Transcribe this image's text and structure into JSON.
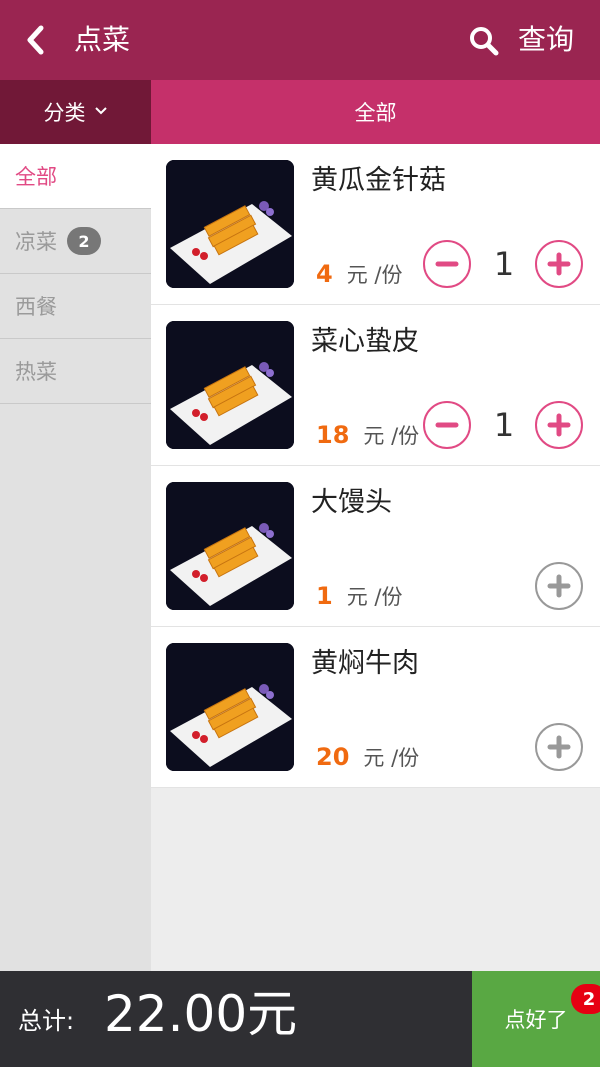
{
  "header": {
    "title": "点菜",
    "search_label": "查询",
    "back_icon": "back-arrow-icon"
  },
  "category_bar": {
    "filter_label": "分类",
    "current": "全部"
  },
  "sidebar": {
    "items": [
      {
        "label": "全部",
        "active": true
      },
      {
        "label": "凉菜",
        "badge": "2"
      },
      {
        "label": "西餐"
      },
      {
        "label": "热菜"
      }
    ]
  },
  "dishes": [
    {
      "name": "黄瓜金针菇",
      "price": "4",
      "unit": "元 /份",
      "qty": "1"
    },
    {
      "name": "菜心蛰皮",
      "price": "18",
      "unit": "元 /份",
      "qty": "1"
    },
    {
      "name": "大馒头",
      "price": "1",
      "unit": "元 /份"
    },
    {
      "name": "黄焖牛肉",
      "price": "20",
      "unit": "元 /份"
    }
  ],
  "footer": {
    "total_label": "总计:",
    "total_amount": "22.00元",
    "submit_label": "点好了",
    "cart_badge": "2"
  },
  "colors": {
    "header": "#9a2551",
    "accent": "#e14a84",
    "price": "#f06a10",
    "submit": "#59a843"
  }
}
